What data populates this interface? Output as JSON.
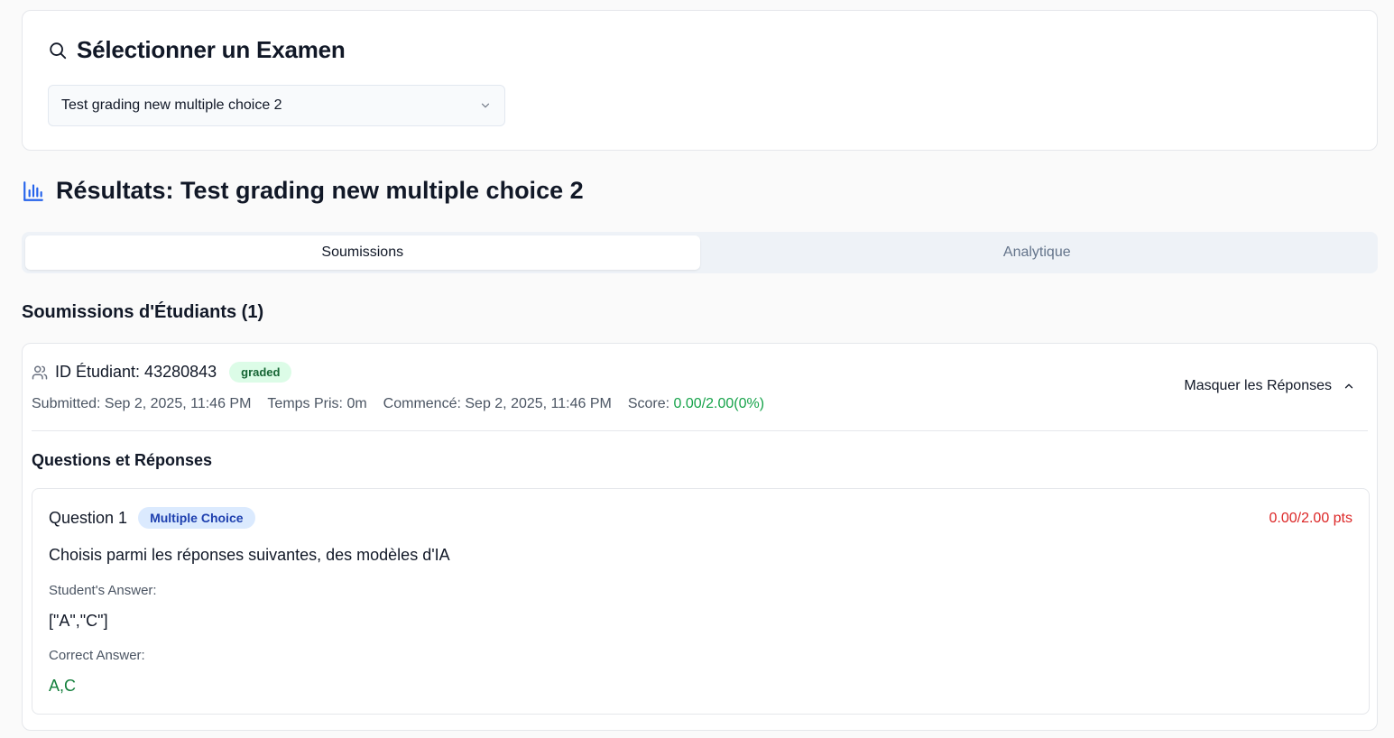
{
  "select_exam": {
    "title": "Sélectionner un Examen",
    "selected_value": "Test grading new multiple choice 2"
  },
  "results": {
    "title": "Résultats: Test grading new multiple choice 2"
  },
  "tabs": [
    {
      "label": "Soumissions",
      "active": true
    },
    {
      "label": "Analytique",
      "active": false
    }
  ],
  "submissions": {
    "heading": "Soumissions d'Étudiants (1)",
    "items": [
      {
        "student_id": "ID Étudiant: 43280843",
        "status": "graded",
        "submitted": "Submitted: Sep 2, 2025, 11:46 PM",
        "time_taken": "Temps Pris: 0m",
        "started": "Commencé: Sep 2, 2025, 11:46 PM",
        "score_label": "Score: ",
        "score_value": "0.00/2.00(0%)",
        "toggle_label": "Masquer les Réponses",
        "qa_heading": "Questions et Réponses",
        "questions": [
          {
            "label": "Question 1",
            "type": "Multiple Choice",
            "points": "0.00/2.00 pts",
            "text": "Choisis parmi les réponses suivantes, des modèles d'IA",
            "student_answer_label": "Student's Answer:",
            "student_answer": "[\"A\",\"C\"]",
            "correct_answer_label": "Correct Answer:",
            "correct_answer": "A,C"
          }
        ]
      }
    ]
  },
  "colors": {
    "accent": "#2563eb",
    "success": "#16a34a",
    "danger": "#dc2626"
  },
  "icons": [
    "search-icon",
    "chevron-down-icon",
    "bar-chart-icon",
    "users-icon",
    "chevron-up-icon"
  ]
}
